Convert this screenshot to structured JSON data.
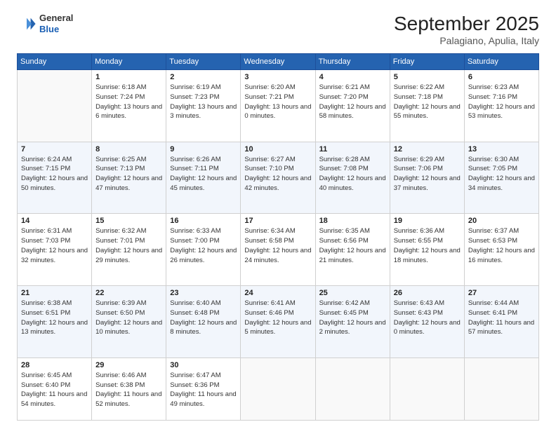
{
  "header": {
    "logo": {
      "line1": "General",
      "line2": "Blue"
    },
    "month": "September 2025",
    "location": "Palagiano, Apulia, Italy"
  },
  "days_of_week": [
    "Sunday",
    "Monday",
    "Tuesday",
    "Wednesday",
    "Thursday",
    "Friday",
    "Saturday"
  ],
  "weeks": [
    [
      {
        "day": "",
        "sunrise": "",
        "sunset": "",
        "daylight": ""
      },
      {
        "day": "1",
        "sunrise": "Sunrise: 6:18 AM",
        "sunset": "Sunset: 7:24 PM",
        "daylight": "Daylight: 13 hours and 6 minutes."
      },
      {
        "day": "2",
        "sunrise": "Sunrise: 6:19 AM",
        "sunset": "Sunset: 7:23 PM",
        "daylight": "Daylight: 13 hours and 3 minutes."
      },
      {
        "day": "3",
        "sunrise": "Sunrise: 6:20 AM",
        "sunset": "Sunset: 7:21 PM",
        "daylight": "Daylight: 13 hours and 0 minutes."
      },
      {
        "day": "4",
        "sunrise": "Sunrise: 6:21 AM",
        "sunset": "Sunset: 7:20 PM",
        "daylight": "Daylight: 12 hours and 58 minutes."
      },
      {
        "day": "5",
        "sunrise": "Sunrise: 6:22 AM",
        "sunset": "Sunset: 7:18 PM",
        "daylight": "Daylight: 12 hours and 55 minutes."
      },
      {
        "day": "6",
        "sunrise": "Sunrise: 6:23 AM",
        "sunset": "Sunset: 7:16 PM",
        "daylight": "Daylight: 12 hours and 53 minutes."
      }
    ],
    [
      {
        "day": "7",
        "sunrise": "Sunrise: 6:24 AM",
        "sunset": "Sunset: 7:15 PM",
        "daylight": "Daylight: 12 hours and 50 minutes."
      },
      {
        "day": "8",
        "sunrise": "Sunrise: 6:25 AM",
        "sunset": "Sunset: 7:13 PM",
        "daylight": "Daylight: 12 hours and 47 minutes."
      },
      {
        "day": "9",
        "sunrise": "Sunrise: 6:26 AM",
        "sunset": "Sunset: 7:11 PM",
        "daylight": "Daylight: 12 hours and 45 minutes."
      },
      {
        "day": "10",
        "sunrise": "Sunrise: 6:27 AM",
        "sunset": "Sunset: 7:10 PM",
        "daylight": "Daylight: 12 hours and 42 minutes."
      },
      {
        "day": "11",
        "sunrise": "Sunrise: 6:28 AM",
        "sunset": "Sunset: 7:08 PM",
        "daylight": "Daylight: 12 hours and 40 minutes."
      },
      {
        "day": "12",
        "sunrise": "Sunrise: 6:29 AM",
        "sunset": "Sunset: 7:06 PM",
        "daylight": "Daylight: 12 hours and 37 minutes."
      },
      {
        "day": "13",
        "sunrise": "Sunrise: 6:30 AM",
        "sunset": "Sunset: 7:05 PM",
        "daylight": "Daylight: 12 hours and 34 minutes."
      }
    ],
    [
      {
        "day": "14",
        "sunrise": "Sunrise: 6:31 AM",
        "sunset": "Sunset: 7:03 PM",
        "daylight": "Daylight: 12 hours and 32 minutes."
      },
      {
        "day": "15",
        "sunrise": "Sunrise: 6:32 AM",
        "sunset": "Sunset: 7:01 PM",
        "daylight": "Daylight: 12 hours and 29 minutes."
      },
      {
        "day": "16",
        "sunrise": "Sunrise: 6:33 AM",
        "sunset": "Sunset: 7:00 PM",
        "daylight": "Daylight: 12 hours and 26 minutes."
      },
      {
        "day": "17",
        "sunrise": "Sunrise: 6:34 AM",
        "sunset": "Sunset: 6:58 PM",
        "daylight": "Daylight: 12 hours and 24 minutes."
      },
      {
        "day": "18",
        "sunrise": "Sunrise: 6:35 AM",
        "sunset": "Sunset: 6:56 PM",
        "daylight": "Daylight: 12 hours and 21 minutes."
      },
      {
        "day": "19",
        "sunrise": "Sunrise: 6:36 AM",
        "sunset": "Sunset: 6:55 PM",
        "daylight": "Daylight: 12 hours and 18 minutes."
      },
      {
        "day": "20",
        "sunrise": "Sunrise: 6:37 AM",
        "sunset": "Sunset: 6:53 PM",
        "daylight": "Daylight: 12 hours and 16 minutes."
      }
    ],
    [
      {
        "day": "21",
        "sunrise": "Sunrise: 6:38 AM",
        "sunset": "Sunset: 6:51 PM",
        "daylight": "Daylight: 12 hours and 13 minutes."
      },
      {
        "day": "22",
        "sunrise": "Sunrise: 6:39 AM",
        "sunset": "Sunset: 6:50 PM",
        "daylight": "Daylight: 12 hours and 10 minutes."
      },
      {
        "day": "23",
        "sunrise": "Sunrise: 6:40 AM",
        "sunset": "Sunset: 6:48 PM",
        "daylight": "Daylight: 12 hours and 8 minutes."
      },
      {
        "day": "24",
        "sunrise": "Sunrise: 6:41 AM",
        "sunset": "Sunset: 6:46 PM",
        "daylight": "Daylight: 12 hours and 5 minutes."
      },
      {
        "day": "25",
        "sunrise": "Sunrise: 6:42 AM",
        "sunset": "Sunset: 6:45 PM",
        "daylight": "Daylight: 12 hours and 2 minutes."
      },
      {
        "day": "26",
        "sunrise": "Sunrise: 6:43 AM",
        "sunset": "Sunset: 6:43 PM",
        "daylight": "Daylight: 12 hours and 0 minutes."
      },
      {
        "day": "27",
        "sunrise": "Sunrise: 6:44 AM",
        "sunset": "Sunset: 6:41 PM",
        "daylight": "Daylight: 11 hours and 57 minutes."
      }
    ],
    [
      {
        "day": "28",
        "sunrise": "Sunrise: 6:45 AM",
        "sunset": "Sunset: 6:40 PM",
        "daylight": "Daylight: 11 hours and 54 minutes."
      },
      {
        "day": "29",
        "sunrise": "Sunrise: 6:46 AM",
        "sunset": "Sunset: 6:38 PM",
        "daylight": "Daylight: 11 hours and 52 minutes."
      },
      {
        "day": "30",
        "sunrise": "Sunrise: 6:47 AM",
        "sunset": "Sunset: 6:36 PM",
        "daylight": "Daylight: 11 hours and 49 minutes."
      },
      {
        "day": "",
        "sunrise": "",
        "sunset": "",
        "daylight": ""
      },
      {
        "day": "",
        "sunrise": "",
        "sunset": "",
        "daylight": ""
      },
      {
        "day": "",
        "sunrise": "",
        "sunset": "",
        "daylight": ""
      },
      {
        "day": "",
        "sunrise": "",
        "sunset": "",
        "daylight": ""
      }
    ]
  ]
}
